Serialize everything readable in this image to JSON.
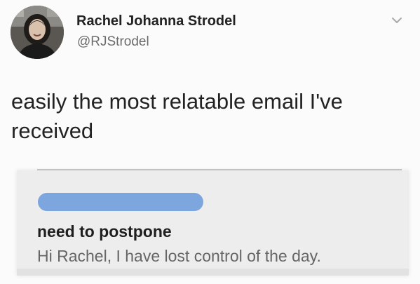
{
  "tweet": {
    "author": {
      "display_name": "Rachel Johanna Strodel",
      "handle": "@RJStrodel"
    },
    "text": "easily the most relatable email I've received",
    "menu_icon": "chevron-down-icon"
  },
  "email": {
    "sender_redacted_color": "#7ea6de",
    "subject": "need to postpone",
    "preview": "Hi Rachel, I have lost control of the day."
  }
}
